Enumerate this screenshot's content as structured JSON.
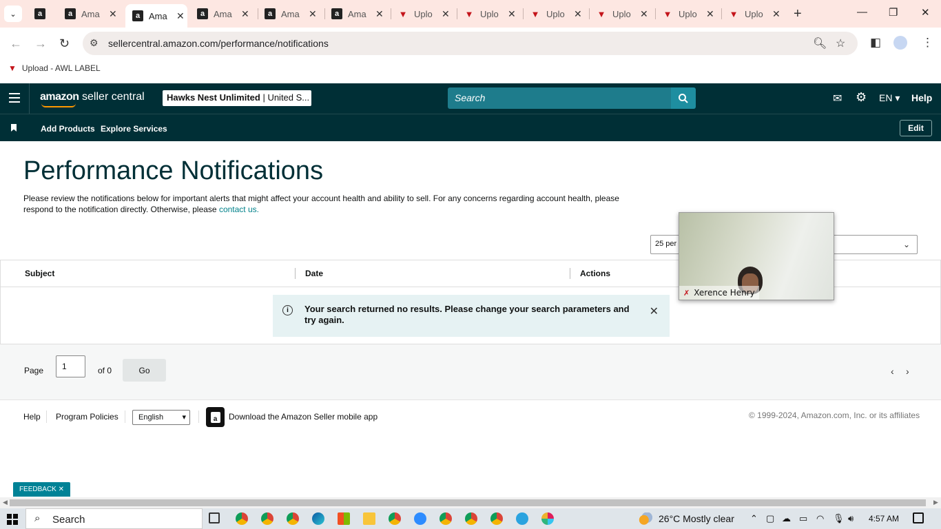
{
  "browser": {
    "tabs": [
      {
        "type": "amazon",
        "label": "",
        "active": false
      },
      {
        "type": "amazon",
        "label": "Ama",
        "active": false
      },
      {
        "type": "amazon",
        "label": "Ama",
        "active": true
      },
      {
        "type": "amazon",
        "label": "Ama",
        "active": false
      },
      {
        "type": "amazon",
        "label": "Ama",
        "active": false
      },
      {
        "type": "amazon",
        "label": "Ama",
        "active": false
      },
      {
        "type": "upload",
        "label": "Uplo",
        "active": false
      },
      {
        "type": "upload",
        "label": "Uplo",
        "active": false
      },
      {
        "type": "upload",
        "label": "Uplo",
        "active": false
      },
      {
        "type": "upload",
        "label": "Uplo",
        "active": false
      },
      {
        "type": "upload",
        "label": "Uplo",
        "active": false
      },
      {
        "type": "upload",
        "label": "Uplo",
        "active": false
      }
    ],
    "url": "sellercentral.amazon.com/performance/notifications",
    "bookmark": "Upload - AWL LABEL"
  },
  "header": {
    "logo_brand": "amazon",
    "logo_product": "seller central",
    "store_name": "Hawks Nest Unlimited",
    "store_region": "| United S...",
    "search_placeholder": "Search",
    "language": "EN",
    "help": "Help"
  },
  "subnav": {
    "links": [
      "Add Products",
      "Explore Services"
    ],
    "edit": "Edit"
  },
  "page": {
    "title": "Performance Notifications",
    "intro": "Please review the notifications below for important alerts that might affect your account health and ability to sell. For any concerns regarding account health, please respond to the notification directly. Otherwise, please",
    "intro_link": "contact us.",
    "per_page": "25 per page"
  },
  "table": {
    "columns": [
      "Subject",
      "Date",
      "Actions"
    ],
    "empty_message": "Your search returned no results. Please change your search parameters and try again."
  },
  "pager": {
    "page_label": "Page",
    "page_value": "1",
    "of_label": "of 0",
    "go": "Go"
  },
  "footer": {
    "links": [
      "Help",
      "Program Policies"
    ],
    "language": "English",
    "app_link": "Download the Amazon Seller mobile app",
    "copyright": "© 1999-2024, Amazon.com, Inc. or its affiliates"
  },
  "feedback": "FEEDBACK",
  "video": {
    "participant": "Xerence Henry"
  },
  "taskbar": {
    "search": "Search",
    "weather": "26°C  Mostly clear",
    "time": "4:57 AM"
  }
}
